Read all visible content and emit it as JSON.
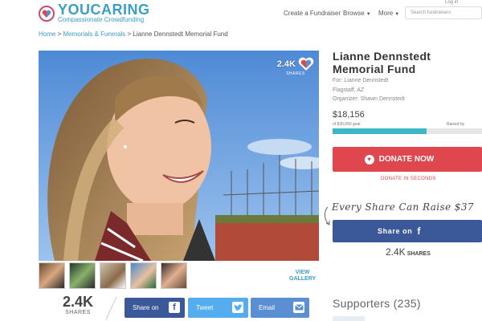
{
  "header": {
    "logo_name": "YOUCARING",
    "logo_tagline": "Compassionate Crowdfunding",
    "nav_create": "Create a Fundraiser",
    "nav_browse": "Browse",
    "nav_more": "More",
    "login": "Log in",
    "search_placeholder": "Search fundraisers"
  },
  "breadcrumb": {
    "home": "Home",
    "sep1": " > ",
    "category": "Memorials & Funerals",
    "sep2": " > ",
    "current": "Lianne Dennstedt Memorial Fund"
  },
  "photo": {
    "share_count": "2.4K",
    "share_label": "SHARES"
  },
  "gallery": {
    "thumbnail_count": 5,
    "view_gallery_line1": "VIEW",
    "view_gallery_line2": "GALLERY"
  },
  "share_row": {
    "count": "2.4K",
    "label": "SHARES",
    "facebook_label": "Share on",
    "twitter_label": "Tweet",
    "email_label": "Email"
  },
  "fundraiser": {
    "title_line1": "Lianne Dennstedt",
    "title_line2": "Memorial Fund",
    "for": "For: Lianne Dennstedt",
    "location": "Flagstaff, AZ",
    "organizer": "Organizer: Shawn Dennstedt",
    "raised": "$18,156",
    "goal": "of $30,000 goal",
    "raised_by": "Raised by",
    "progress_fraction": 0.63,
    "donate_label": "DONATE NOW",
    "donate_note": "DONATE IN SECONDS",
    "every_share": "Every Share Can Raise $37",
    "share_on_label": "Share on",
    "shares_count": "2.4K",
    "shares_label": "SHARES",
    "supporters": "Supporters (235)"
  },
  "colors": {
    "brand_blue": "#3a9fc8",
    "donate_red": "#e0464d",
    "facebook": "#3b5998",
    "twitter": "#55acee",
    "email": "#5b8fd4",
    "progress": "#3bb7c8"
  }
}
